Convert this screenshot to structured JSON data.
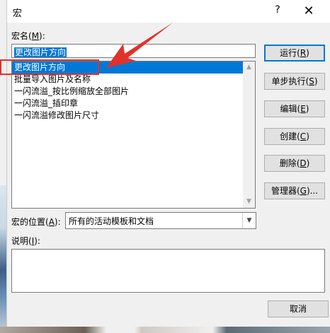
{
  "dialog": {
    "title": "宏",
    "help_glyph": "?",
    "close_glyph": "✕"
  },
  "macro_name": {
    "label_prefix": "宏名(",
    "label_key": "M",
    "label_suffix": "):",
    "value": "更改图片方向"
  },
  "macro_list": {
    "items": [
      "更改图片方向",
      "批量导入图片及名称",
      "一闪流溢_按比例缩放全部图片",
      "一闪流溢_插印章",
      "一闪流溢修改图片尺寸"
    ],
    "selected_index": 0
  },
  "buttons": {
    "run": {
      "text": "运行(",
      "key": "R",
      "end": ")"
    },
    "step": {
      "text": "单步执行(",
      "key": "S",
      "end": ")"
    },
    "edit": {
      "text": "编辑(",
      "key": "E",
      "end": ")"
    },
    "create": {
      "text": "创建(",
      "key": "C",
      "end": ")"
    },
    "delete": {
      "text": "删除(",
      "key": "D",
      "end": ")"
    },
    "organizer": {
      "text": "管理器(",
      "key": "G",
      "end": ")..."
    },
    "cancel": "取消"
  },
  "location": {
    "label_prefix": "宏的位置(",
    "label_key": "A",
    "label_suffix": "):",
    "value": "所有的活动模板和文档"
  },
  "description": {
    "label_prefix": "说明(",
    "label_key": "I",
    "label_suffix": "):",
    "value": ""
  },
  "annotation": {
    "color": "#e0322b"
  }
}
